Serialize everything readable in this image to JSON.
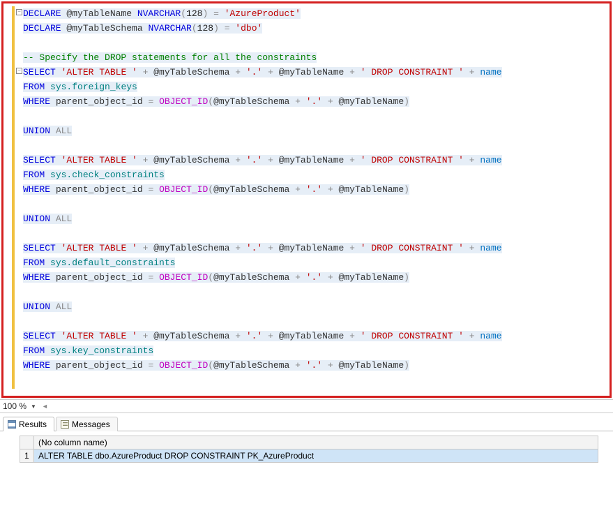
{
  "code": {
    "l1": {
      "a": "DECLARE",
      "b": " @myTableName ",
      "c": "NVARCHAR",
      "d": "(",
      "e": "128",
      "f": ")",
      "g": " = ",
      "h": "'AzureProduct'"
    },
    "l2": {
      "a": "DECLARE",
      "b": " @myTableSchema ",
      "c": "NVARCHAR",
      "d": "(",
      "e": "128",
      "f": ")",
      "g": " = ",
      "h": "'dbo'"
    },
    "l3": "",
    "l4": "-- Specify the DROP statements for all the constraints",
    "sel_block": {
      "sel": "SELECT",
      "alter": "'ALTER TABLE '",
      "plus": " + ",
      "schemaV": "@myTableSchema",
      "dot": "'.'",
      "tableV": "@myTableName",
      "drop": "' DROP CONSTRAINT '",
      "name": "name",
      "from": "FROM",
      "where": "WHERE",
      "parent": " parent_object_id ",
      "eq": "= ",
      "fn": "OBJECT_ID",
      "open": "(",
      "close": ")"
    },
    "tables": {
      "fk": "sys.foreign_keys",
      "ck": "sys.check_constraints",
      "df": "sys.default_constraints",
      "kc": "sys.key_constraints"
    },
    "union": {
      "a": "UNION",
      "b": "ALL"
    }
  },
  "zoom": {
    "value": "100 %"
  },
  "tabs": {
    "results": "Results",
    "messages": "Messages"
  },
  "grid": {
    "header": "(No column name)",
    "rownum": "1",
    "value": "ALTER TABLE dbo.AzureProduct DROP CONSTRAINT PK_AzureProduct"
  }
}
